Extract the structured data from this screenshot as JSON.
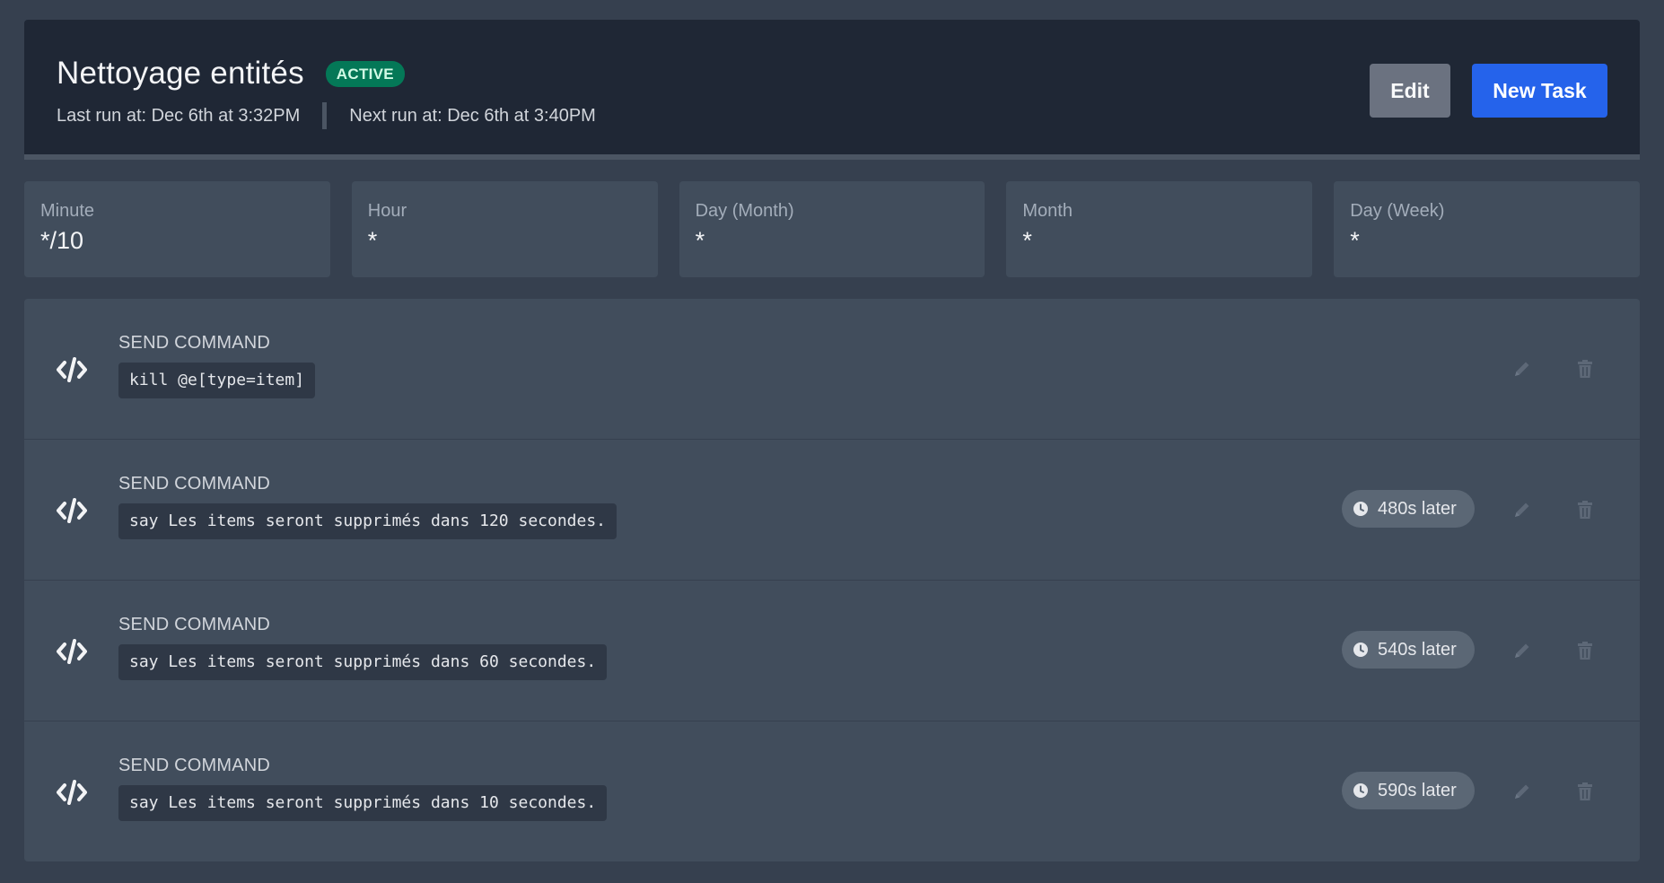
{
  "header": {
    "title": "Nettoyage entités",
    "status_badge": "ACTIVE",
    "last_run": "Last run at: Dec 6th at 3:32PM",
    "next_run": "Next run at: Dec 6th at 3:40PM",
    "edit_label": "Edit",
    "new_task_label": "New Task"
  },
  "cron": [
    {
      "label": "Minute",
      "value": "*/10"
    },
    {
      "label": "Hour",
      "value": "*"
    },
    {
      "label": "Day (Month)",
      "value": "*"
    },
    {
      "label": "Month",
      "value": "*"
    },
    {
      "label": "Day (Week)",
      "value": "*"
    }
  ],
  "tasks": [
    {
      "type": "SEND COMMAND",
      "command": "kill @e[type=item]",
      "delay": ""
    },
    {
      "type": "SEND COMMAND",
      "command": "say Les items seront supprimés dans 120 secondes.",
      "delay": "480s later"
    },
    {
      "type": "SEND COMMAND",
      "command": "say Les items seront supprimés dans 60 secondes.",
      "delay": "540s later"
    },
    {
      "type": "SEND COMMAND",
      "command": "say Les items seront supprimés dans 10 secondes.",
      "delay": "590s later"
    }
  ],
  "icons": {
    "task_type": "code-icon",
    "delay": "clock-icon",
    "edit": "pencil-icon",
    "delete": "trash-icon"
  },
  "colors": {
    "background": "#36404f",
    "header_bg": "#1f2735",
    "card_bg": "#414d5c",
    "active_badge": "#047857",
    "primary_button": "#2563eb",
    "secondary_button": "#6b7280"
  }
}
